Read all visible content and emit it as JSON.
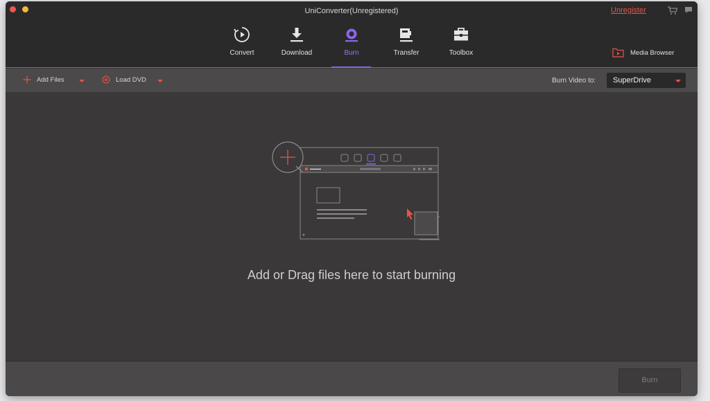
{
  "window": {
    "title": "UniConverter(Unregistered)"
  },
  "header": {
    "unregister_label": "Unregister",
    "cart_icon": "cart-icon",
    "message_icon": "message-icon"
  },
  "nav": {
    "items": [
      {
        "label": "Convert",
        "icon": "convert-icon"
      },
      {
        "label": "Download",
        "icon": "download-icon"
      },
      {
        "label": "Burn",
        "icon": "burn-icon",
        "active": true
      },
      {
        "label": "Transfer",
        "icon": "transfer-icon"
      },
      {
        "label": "Toolbox",
        "icon": "toolbox-icon"
      }
    ],
    "media_browser_label": "Media Browser"
  },
  "toolbar": {
    "add_files_label": "Add Files",
    "load_dvd_label": "Load DVD",
    "burn_to_label": "Burn Video to:",
    "burn_to_value": "SuperDrive"
  },
  "content": {
    "hint": "Add or Drag files here to start burning"
  },
  "footer": {
    "burn_label": "Burn"
  },
  "colors": {
    "accent": "#8e66e8",
    "red": "#e8534c",
    "background": "#3a3839"
  }
}
